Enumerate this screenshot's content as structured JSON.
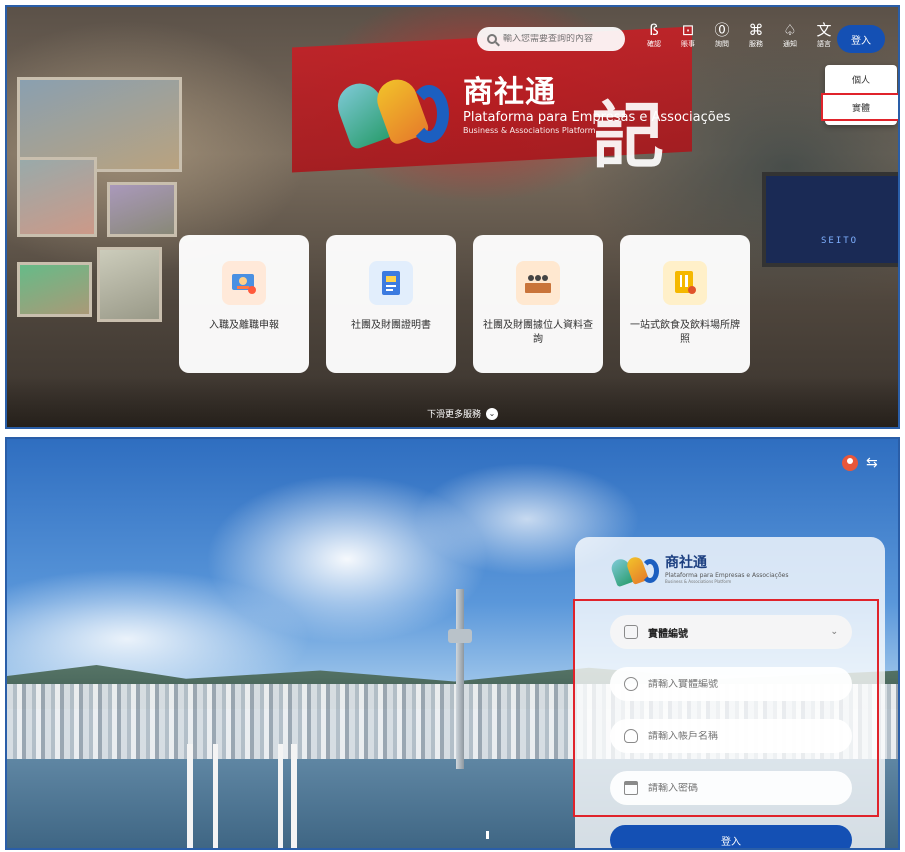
{
  "top_screen": {
    "search": {
      "placeholder": "輸入您需要查詢的內容"
    },
    "nav_icons": [
      {
        "icon": "verify-icon",
        "label": "確認",
        "glyph": "ß"
      },
      {
        "icon": "account-icon",
        "label": "賬事",
        "glyph": "⊡"
      },
      {
        "icon": "help-icon",
        "label": "詢問",
        "glyph": "⓪"
      },
      {
        "icon": "services-icon",
        "label": "服務",
        "glyph": "⌘"
      },
      {
        "icon": "bell-icon",
        "label": "通知",
        "glyph": "♤"
      },
      {
        "icon": "language-icon",
        "label": "語言",
        "glyph": "文"
      }
    ],
    "login_label": "登入",
    "dropdown": {
      "personal": "個人",
      "entity": "實體"
    },
    "logo": {
      "zh": "商社通",
      "pt": "Plataforma para Empresas e Associações",
      "en": "Business & Associations Platform"
    },
    "banner_char": "記",
    "cards": [
      {
        "label": "入職及離職申報",
        "icon": "employment-declaration-icon"
      },
      {
        "label": "社團及財團證明書",
        "icon": "certificate-icon"
      },
      {
        "label": "社團及財團據位人資料查詢",
        "icon": "officeholders-icon"
      },
      {
        "label": "一站式飲食及飲料場所牌照",
        "icon": "restaurant-license-icon"
      }
    ],
    "scroll_hint": "下滑更多服務",
    "screen_text": "SEITO"
  },
  "bottom_screen": {
    "logo": {
      "zh": "商社通",
      "pt": "Plataforma para Empresas e Associações",
      "en": "Business & Associations Platform"
    },
    "entity_type": "實體編號",
    "entity_number_placeholder": "請輸入實體編號",
    "username_placeholder": "請輸入帳戶名稱",
    "password_placeholder": "請輸入密碼",
    "login_label": "登入"
  },
  "colors": {
    "brand_blue": "#1450b4",
    "highlight_red": "#e0232b",
    "frame_blue": "#2a5ea8"
  }
}
